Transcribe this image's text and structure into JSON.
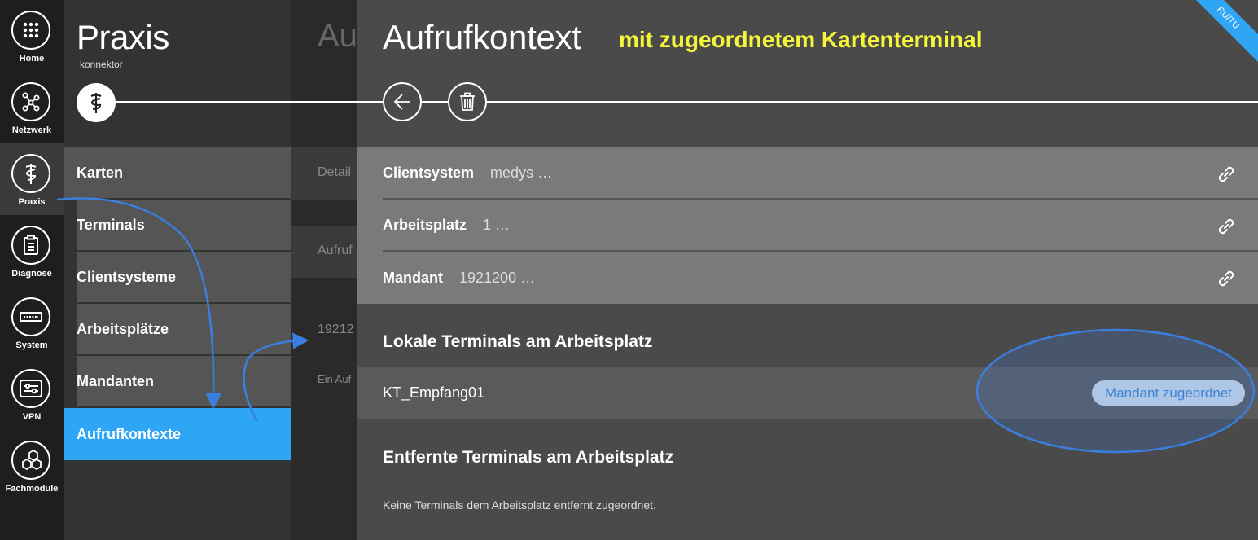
{
  "rail": {
    "items": [
      {
        "label": "Home",
        "icon": "grid-icon"
      },
      {
        "label": "Netzwerk",
        "icon": "network-icon"
      },
      {
        "label": "Praxis",
        "icon": "caduceus-icon"
      },
      {
        "label": "Diagnose",
        "icon": "clipboard-icon"
      },
      {
        "label": "System",
        "icon": "server-icon"
      },
      {
        "label": "VPN",
        "icon": "sliders-icon"
      },
      {
        "label": "Fachmodule",
        "icon": "hexagons-icon"
      }
    ]
  },
  "praxis": {
    "title": "Praxis",
    "subtitle": "konnektor",
    "menu": [
      "Karten",
      "Terminals",
      "Clientsysteme",
      "Arbeitsplätze",
      "Mandanten",
      "Aufrufkontexte"
    ]
  },
  "mid": {
    "title": "Au",
    "row1": "Detail",
    "row2": "Aufruf",
    "row3": "19212",
    "row4": "Ein Auf"
  },
  "main": {
    "title": "Aufrufkontext",
    "annotation": "mit zugeordnetem Kartenterminal",
    "ribbon": "RU/TU",
    "properties": [
      {
        "label": "Clientsystem",
        "value": "medys …"
      },
      {
        "label": "Arbeitsplatz",
        "value": "1 …"
      },
      {
        "label": "Mandant",
        "value": "1921200 …"
      }
    ],
    "local_heading": "Lokale Terminals am Arbeitsplatz",
    "local_terminal": "KT_Empfang01",
    "local_status": "Mandant zugeordnet",
    "remote_heading": "Entfernte Terminals am Arbeitsplatz",
    "remote_empty": "Keine Terminals dem Arbeitsplatz entfernt zugeordnet."
  },
  "colors": {
    "accent": "#2ea5f5",
    "annotation": "#f5f53a",
    "highlight_ellipse": "#3a7fe0"
  }
}
